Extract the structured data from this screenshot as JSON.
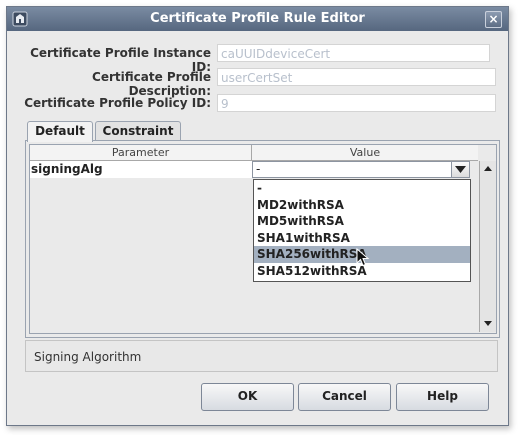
{
  "window": {
    "title": "Certificate Profile Rule Editor",
    "close_symbol": "×"
  },
  "form": {
    "instance_id": {
      "label": "Certificate Profile Instance ID:",
      "value": "caUUIDdeviceCert"
    },
    "description": {
      "label": "Certificate Profile Description:",
      "value": "userCertSet"
    },
    "policy_id": {
      "label": "Certificate Profile Policy ID:",
      "value": "9"
    }
  },
  "tabs": [
    {
      "label": "Default",
      "active": true
    },
    {
      "label": "Constraint",
      "active": false
    }
  ],
  "table": {
    "columns": [
      "Parameter",
      "Value"
    ],
    "rows": [
      {
        "parameter": "signingAlg",
        "value": "-"
      }
    ]
  },
  "dropdown": {
    "options": [
      "-",
      "MD2withRSA",
      "MD5withRSA",
      "SHA1withRSA",
      "SHA256withRSA",
      "SHA512withRSA"
    ],
    "highlighted": "SHA256withRSA"
  },
  "description_text": "Signing Algorithm",
  "buttons": {
    "ok": "OK",
    "cancel": "Cancel",
    "help": "Help"
  },
  "colors": {
    "titlebar": "#667891",
    "selection": "#a3b0c0"
  },
  "icons": {
    "app": "app-icon",
    "close": "close-icon",
    "combo_arrow": "chevron-down-icon",
    "scroll_up": "scroll-up-icon",
    "scroll_down": "scroll-down-icon",
    "cursor": "mouse-pointer-icon"
  }
}
